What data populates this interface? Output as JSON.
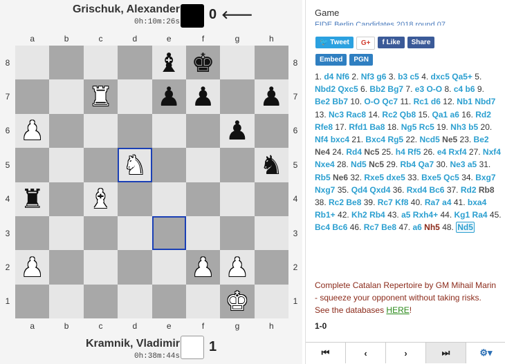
{
  "top_player": {
    "name": "Grischuk, Alexander",
    "clock": "0h:10m:26s",
    "score": "0",
    "color": "#000000",
    "turn_arrow": "🡐"
  },
  "bottom_player": {
    "name": "Kramnik, Vladimir",
    "clock": "0h:38m:44s",
    "score": "1",
    "color": "#ffffff"
  },
  "files": [
    "a",
    "b",
    "c",
    "d",
    "e",
    "f",
    "g",
    "h"
  ],
  "ranks": [
    "8",
    "7",
    "6",
    "5",
    "4",
    "3",
    "2",
    "1"
  ],
  "board": [
    [
      "",
      "",
      "",
      "",
      "b",
      "k",
      "",
      ""
    ],
    [
      "",
      "",
      "R",
      "",
      "p",
      "p",
      "",
      "p"
    ],
    [
      "P",
      "",
      "",
      "",
      "",
      "",
      "p",
      ""
    ],
    [
      "",
      "",
      "",
      "N",
      "",
      "",
      "",
      "n"
    ],
    [
      "r",
      "",
      "B",
      "",
      "",
      "",
      "",
      ""
    ],
    [
      "",
      "",
      "",
      "",
      "",
      "",
      "",
      ""
    ],
    [
      "P",
      "",
      "",
      "",
      "",
      "P",
      "P",
      ""
    ],
    [
      "",
      "",
      "",
      "",
      "",
      "",
      "K",
      ""
    ]
  ],
  "highlight_squares": [
    "d5",
    "e3"
  ],
  "panel": {
    "title": "Game",
    "subtitle": "FIDE Berlin Candidates 2018 round 07",
    "share_buttons": [
      "Tweet",
      "G+",
      "Like",
      "Share"
    ],
    "tool_buttons": [
      "Embed",
      "PGN"
    ]
  },
  "moves": [
    {
      "n": "1.",
      "w": "d4",
      "b": "Nf6"
    },
    {
      "n": "2.",
      "w": "Nf3",
      "b": "g6"
    },
    {
      "n": "3.",
      "w": "b3",
      "b": "c5"
    },
    {
      "n": "4.",
      "w": "dxc5",
      "b": "Qa5+"
    },
    {
      "n": "5.",
      "w": "Nbd2",
      "b": "Qxc5"
    },
    {
      "n": "6.",
      "w": "Bb2",
      "b": "Bg7"
    },
    {
      "n": "7.",
      "w": "e3",
      "b": "O-O"
    },
    {
      "n": "8.",
      "w": "c4",
      "b": "b6"
    },
    {
      "n": "9.",
      "w": "Be2",
      "b": "Bb7"
    },
    {
      "n": "10.",
      "w": "O-O",
      "b": "Qc7"
    },
    {
      "n": "11.",
      "w": "Rc1",
      "b": "d6"
    },
    {
      "n": "12.",
      "w": "Nb1",
      "b": "Nbd7"
    },
    {
      "n": "13.",
      "w": "Nc3",
      "b": "Rac8"
    },
    {
      "n": "14.",
      "w": "Rc2",
      "b": "Qb8"
    },
    {
      "n": "15.",
      "w": "Qa1",
      "b": "a6"
    },
    {
      "n": "16.",
      "w": "Rd2",
      "b": "Rfe8"
    },
    {
      "n": "17.",
      "w": "Rfd1",
      "b": "Ba8"
    },
    {
      "n": "18.",
      "w": "Ng5",
      "b": "Rc5"
    },
    {
      "n": "19.",
      "w": "Nh3",
      "b": "b5"
    },
    {
      "n": "20.",
      "w": "Nf4",
      "b": "bxc4"
    },
    {
      "n": "21.",
      "w": "Bxc4",
      "b": "Rg5"
    },
    {
      "n": "22.",
      "w": "Ncd5",
      "b": "Ne5"
    },
    {
      "n": "23.",
      "w": "Be2",
      "b": "Ne4"
    },
    {
      "n": "24.",
      "w": "Rd4",
      "b": "Nc5"
    },
    {
      "n": "25.",
      "w": "h4",
      "b": "Rf5"
    },
    {
      "n": "26.",
      "w": "e4",
      "b": "Rxf4"
    },
    {
      "n": "27.",
      "w": "Nxf4",
      "b": "Nxe4"
    },
    {
      "n": "28.",
      "w": "Nd5",
      "b": "Nc5"
    },
    {
      "n": "29.",
      "w": "Rb4",
      "b": "Qa7"
    },
    {
      "n": "30.",
      "w": "Ne3",
      "b": "a5"
    },
    {
      "n": "31.",
      "w": "Rb5",
      "b": "Ne6"
    },
    {
      "n": "32.",
      "w": "Rxe5",
      "b": "dxe5"
    },
    {
      "n": "33.",
      "w": "Bxe5",
      "b": "Qc5"
    },
    {
      "n": "34.",
      "w": "Bxg7",
      "b": "Nxg7"
    },
    {
      "n": "35.",
      "w": "Qd4",
      "b": "Qxd4"
    },
    {
      "n": "36.",
      "w": "Rxd4",
      "b": "Bc6"
    },
    {
      "n": "37.",
      "w": "Rd2",
      "b": "Rb8"
    },
    {
      "n": "38.",
      "w": "Rc2",
      "b": "Be8"
    },
    {
      "n": "39.",
      "w": "Rc7",
      "b": "Kf8"
    },
    {
      "n": "40.",
      "w": "Ra7",
      "b": "a4"
    },
    {
      "n": "41.",
      "w": "bxa4",
      "b": "Rb1+"
    },
    {
      "n": "42.",
      "w": "Kh2",
      "b": "Rb4"
    },
    {
      "n": "43.",
      "w": "a5",
      "b": "Rxh4+"
    },
    {
      "n": "44.",
      "w": "Kg1",
      "b": "Ra4"
    },
    {
      "n": "45.",
      "w": "Bc4",
      "b": "Bc6"
    },
    {
      "n": "46.",
      "w": "Rc7",
      "b": "Be8"
    },
    {
      "n": "47.",
      "w": "a6",
      "b": "Nh5"
    },
    {
      "n": "48.",
      "w": "Nd5",
      "b": ""
    }
  ],
  "promo": {
    "text": "Complete Catalan Repertoire by GM Mihail Marin - squeeze your opponent without taking risks. See the databases ",
    "link": "HERE",
    "tail": "!"
  },
  "result": "1-0",
  "nav": {
    "first": "⏮",
    "prev": "‹",
    "next": "›",
    "last": "⏭",
    "settings": "⚙▾"
  },
  "colors": {
    "accent": "#2b9fd0",
    "highlight": "#1a3fb5",
    "light_square": "#e6e6e6",
    "dark_square": "#a8a8a8"
  }
}
